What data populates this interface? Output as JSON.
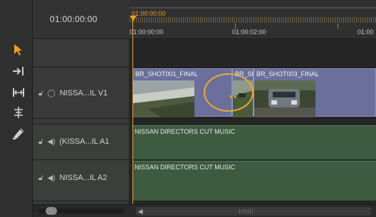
{
  "header": {
    "timecode": "01:00:00:00",
    "playhead_timecode": "01:00:00:00",
    "ruler_labels": [
      "01:00:00:00",
      "01:00:02:00",
      "01:00"
    ]
  },
  "tools": [
    {
      "name": "selection-tool-icon"
    },
    {
      "name": "track-select-tool-icon"
    },
    {
      "name": "ripple-edit-tool-icon"
    },
    {
      "name": "rolling-edit-tool-icon"
    },
    {
      "name": "razor-tool-icon"
    }
  ],
  "tracks": {
    "v1": {
      "name": "NISSA...IL V1",
      "clips": [
        {
          "label": "BR_SHOT001_FINAL"
        },
        {
          "label": "BR_SI"
        },
        {
          "label": "BR_SHOT003_FINAL"
        }
      ]
    },
    "a1": {
      "name": "(KISSA...IL A1",
      "clip_label": "NISSAN DIRECTORS CUT MUSIC"
    },
    "a2": {
      "name": "NISSA...IL A2",
      "clip_label": "NISSAN DIRECTORS CUT MUSIC"
    }
  },
  "colors": {
    "playhead": "#e6a23c",
    "video_clip": "#6a6f9c",
    "audio_clip": "#3c5b3f",
    "highlight_ring": "#f0a830"
  }
}
